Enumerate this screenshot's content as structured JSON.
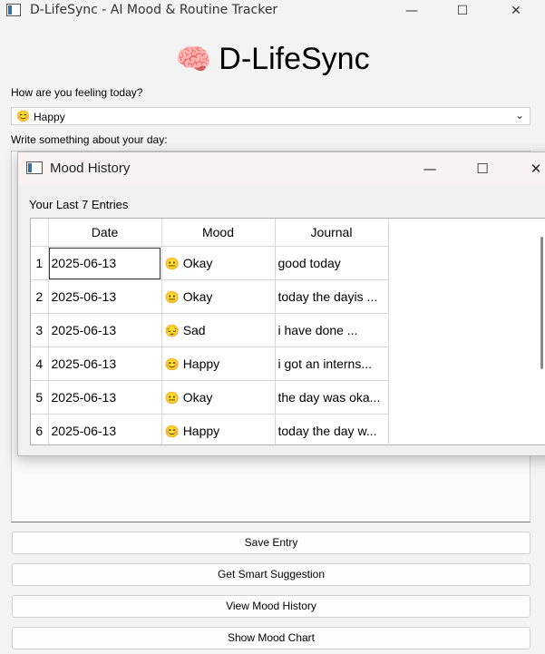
{
  "window": {
    "title": "D-LifeSync - AI Mood & Routine Tracker",
    "minimize_glyph": "—",
    "maximize_glyph": "☐",
    "close_glyph": "✕"
  },
  "header": {
    "brain_emoji": "🧠",
    "title": "D-LifeSync"
  },
  "form": {
    "feeling_label": "How are you feeling today?",
    "mood_emoji": "😊",
    "mood_value": "Happy",
    "dropdown_glyph": "⌄",
    "journal_label": "Write something about your day:"
  },
  "buttons": {
    "save": "Save Entry",
    "suggestion": "Get Smart Suggestion",
    "history": "View Mood History",
    "chart": "Show Mood Chart"
  },
  "dialog": {
    "title": "Mood History",
    "subtitle": "Your Last 7 Entries",
    "columns": [
      "Date",
      "Mood",
      "Journal"
    ],
    "rows": [
      {
        "num": "1",
        "date": "2025-06-13",
        "emoji": "😐",
        "mood": "Okay",
        "journal": "good today"
      },
      {
        "num": "2",
        "date": "2025-06-13",
        "emoji": "😐",
        "mood": "Okay",
        "journal": "today the dayis ..."
      },
      {
        "num": "3",
        "date": "2025-06-13",
        "emoji": "😔",
        "mood": "Sad",
        "journal": "i have done ..."
      },
      {
        "num": "4",
        "date": "2025-06-13",
        "emoji": "😊",
        "mood": "Happy",
        "journal": "i got an interns..."
      },
      {
        "num": "5",
        "date": "2025-06-13",
        "emoji": "😐",
        "mood": "Okay",
        "journal": "the day was oka..."
      },
      {
        "num": "6",
        "date": "2025-06-13",
        "emoji": "😊",
        "mood": "Happy",
        "journal": "today the day w..."
      }
    ]
  },
  "icons": {
    "app": "app-window-icon",
    "brain": "brain-icon",
    "chevron": "chevron-down-icon"
  }
}
